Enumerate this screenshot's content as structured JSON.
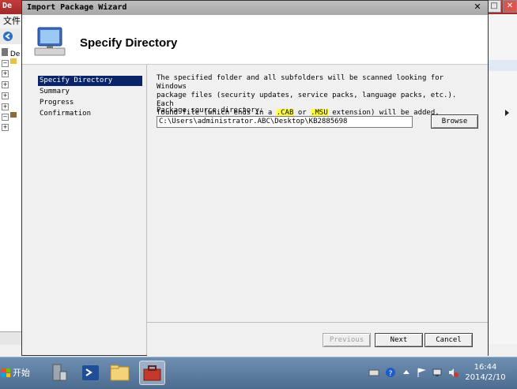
{
  "background_window": {
    "title": "De",
    "menu_file": "文件",
    "tree_item": "De"
  },
  "wizard": {
    "title": "Import Package Wizard",
    "close_glyph": "✕",
    "header_title": "Specify Directory",
    "nav": [
      {
        "label": "Specify Directory",
        "active": true
      },
      {
        "label": "Summary",
        "active": false
      },
      {
        "label": "Progress",
        "active": false
      },
      {
        "label": "Confirmation",
        "active": false
      }
    ],
    "description_lines": [
      "The specified folder and all subfolders will be scanned looking for Windows",
      "package files (security updates, service packs, language packs, etc.).  Each"
    ],
    "description_line3": {
      "before": "found file (which ends in a ",
      "ext1": ".CAB",
      "middle": " or ",
      "ext2": ".MSU",
      "after": " extension) will be added."
    },
    "source_label": "Package source directory:",
    "source_value": "C:\\Users\\administrator.ABC\\Desktop\\KB2885698",
    "browse_label": "Browse",
    "previous_label": "Previous",
    "next_label": "Next",
    "cancel_label": "Cancel"
  },
  "taskbar": {
    "start_label": "开始",
    "time": "16:44",
    "date": "2014/2/10"
  },
  "colors": {
    "highlight": "#ffff3c",
    "nav_active": "#0a246a"
  }
}
